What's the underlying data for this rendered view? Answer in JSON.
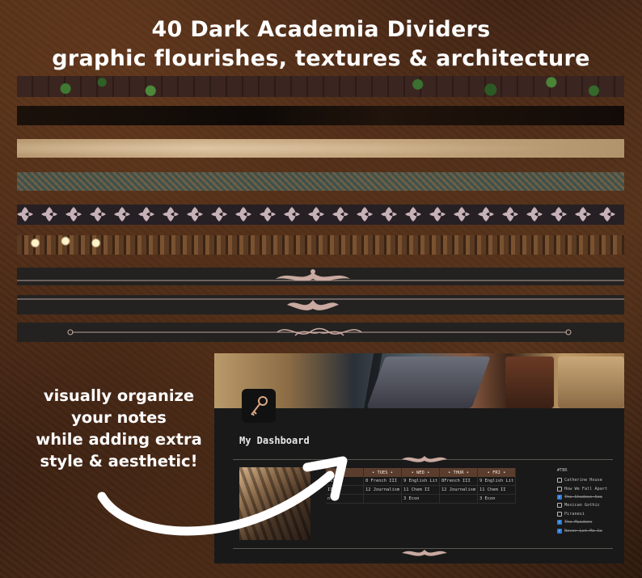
{
  "header": {
    "line1": "40 Dark Academia Dividers",
    "line2": "graphic flourishes, textures & architecture"
  },
  "side_text": {
    "lines": [
      "visually organize",
      "your notes",
      "while adding extra",
      "style & aesthetic!"
    ]
  },
  "dashboard": {
    "title": "My Dashboard",
    "icon": "key-icon",
    "schedule": {
      "headers": [
        "",
        "• TUES •",
        "• WED •",
        "• THUR •",
        "• FRI •"
      ],
      "rows": [
        [
          "Lit",
          "8 French III",
          "9 English Lit",
          "8French III",
          "9 English Lit"
        ],
        [
          "II",
          "12 Journalism",
          "11 Chem II",
          "12 Journalism",
          "11 Chem II"
        ],
        [
          "n",
          "",
          "3 Econ",
          "",
          "3 Econ"
        ]
      ]
    },
    "tbr": {
      "heading": "#TBR",
      "items": [
        {
          "title": "Catherine House",
          "checked": false
        },
        {
          "title": "How We Fall Apart",
          "checked": false
        },
        {
          "title": "The Shadows Sea",
          "checked": true
        },
        {
          "title": "Mexican Gothic",
          "checked": false
        },
        {
          "title": "Piranesi",
          "checked": false
        },
        {
          "title": "The Maidens",
          "checked": true
        },
        {
          "title": "Never Let Me Go",
          "checked": true
        }
      ]
    }
  },
  "colors": {
    "leather": "#3b2012",
    "panel": "#191919",
    "schedule_header": "#5b3d2e",
    "checkbox_on": "#2f7bd6",
    "ornament": "#c9a9a0"
  }
}
